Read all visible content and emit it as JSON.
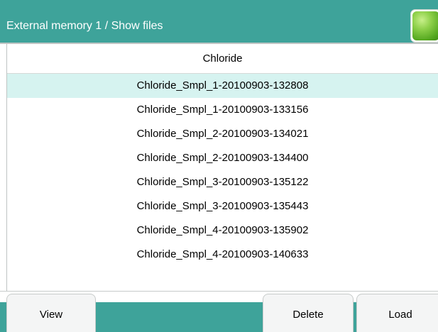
{
  "window": {
    "title": "External memory 1 / Show files",
    "status_led_color": "#6fbe2f"
  },
  "list": {
    "header": "Chloride",
    "selected_index": 0,
    "files": [
      "Chloride_Smpl_1-20100903-132808",
      "Chloride_Smpl_1-20100903-133156",
      "Chloride_Smpl_2-20100903-134021",
      "Chloride_Smpl_2-20100903-134400",
      "Chloride_Smpl_3-20100903-135122",
      "Chloride_Smpl_3-20100903-135443",
      "Chloride_Smpl_4-20100903-135902",
      "Chloride_Smpl_4-20100903-140633"
    ]
  },
  "softkeys": {
    "view": "View",
    "delete": "Delete",
    "load": "Load"
  },
  "colors": {
    "accent": "#3ea39a",
    "selection": "#d6f3f0"
  }
}
